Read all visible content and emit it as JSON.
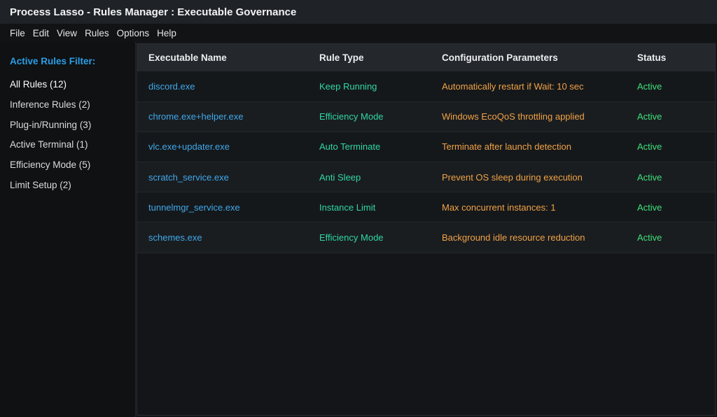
{
  "window": {
    "title": "Process Lasso - Rules Manager : Executable Governance"
  },
  "menu": [
    "File",
    "Edit",
    "View",
    "Rules",
    "Options",
    "Help"
  ],
  "sidebar": {
    "title": "Active Rules Filter:",
    "items": [
      "All Rules (12)",
      "Inference Rules (2)",
      "Plug-in/Running (3)",
      "Active Terminal (1)",
      "Efficiency Mode (5)",
      "Limit Setup (2)"
    ]
  },
  "table": {
    "headers": [
      "Executable Name",
      "Rule Type",
      "Configuration Parameters",
      "Status"
    ],
    "rows": [
      {
        "exe": "discord.exe",
        "type": "Keep Running",
        "config": "Automatically restart if Wait: 10 sec",
        "status": "Active"
      },
      {
        "exe": "chrome.exe+helper.exe",
        "type": "Efficiency Mode",
        "config": "Windows EcoQoS throttling applied",
        "status": "Active"
      },
      {
        "exe": "vlc.exe+updater.exe",
        "type": "Auto Terminate",
        "config": "Terminate after launch detection",
        "status": "Active"
      },
      {
        "exe": "scratch_service.exe",
        "type": "Anti Sleep",
        "config": "Prevent OS sleep during execution",
        "status": "Active"
      },
      {
        "exe": "tunnelmgr_service.exe",
        "type": "Instance Limit",
        "config": "Max concurrent instances: 1",
        "status": "Active"
      },
      {
        "exe": "schemes.exe",
        "type": "Efficiency Mode",
        "config": "Background idle resource reduction",
        "status": "Active"
      }
    ]
  },
  "colors": {
    "accent_blue": "#2b9fe6",
    "exe_blue": "#3fa9ec",
    "rule_type_teal": "#2fd8a0",
    "config_orange": "#f0a246",
    "status_green": "#3fe07a"
  }
}
